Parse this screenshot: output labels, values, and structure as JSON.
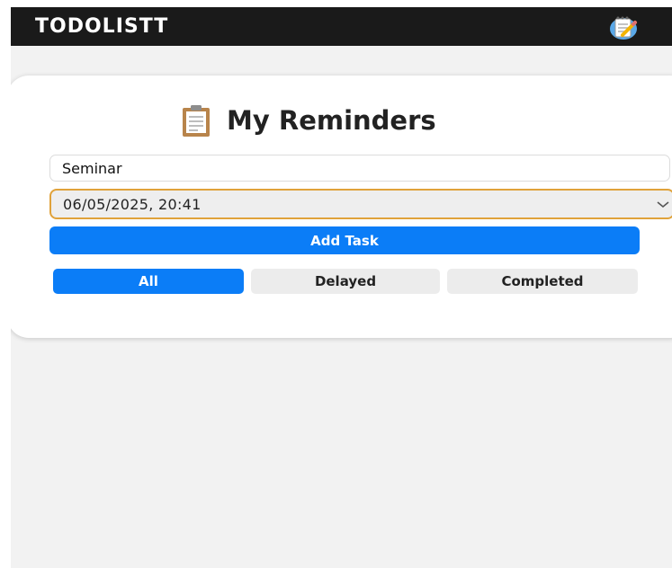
{
  "appbar": {
    "title": "TODOLISTT",
    "logo_icon": "notepad-pencil-icon"
  },
  "card": {
    "heading_icon": "clipboard-icon",
    "heading": "My Reminders",
    "task_input": {
      "value": "Seminar"
    },
    "datetime": {
      "value": "06/05/2025, 20:41",
      "icon": "chevron-down-icon"
    },
    "add_button_label": "Add Task",
    "filters": [
      {
        "label": "All",
        "active": true
      },
      {
        "label": "Delayed",
        "active": false
      },
      {
        "label": "Completed",
        "active": false
      }
    ]
  },
  "colors": {
    "appbar": "#1a1a1a",
    "accent": "#0b7df7",
    "date_border": "#e0a23a",
    "background": "#f2f2f2"
  }
}
